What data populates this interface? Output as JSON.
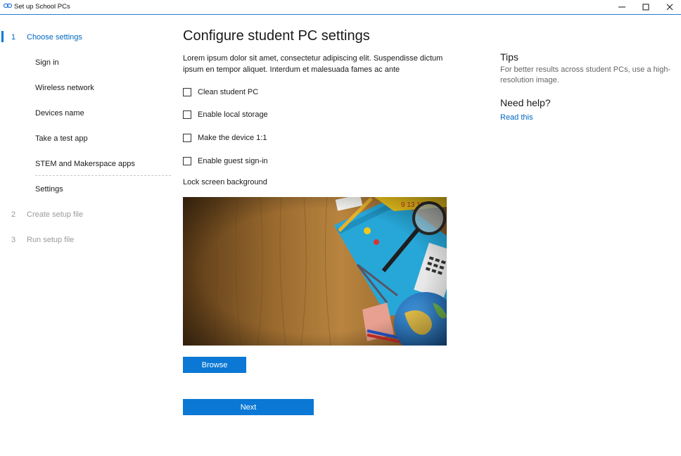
{
  "window": {
    "title": "Set up School PCs",
    "icon": "chain-link-icon",
    "controls": [
      "minimize-icon",
      "maximize-icon",
      "close-icon"
    ]
  },
  "sidebar": {
    "steps": [
      {
        "number": "1",
        "label": "Choose settings",
        "state": "active"
      },
      {
        "number": "2",
        "label": "Create setup file",
        "state": "disabled"
      },
      {
        "number": "3",
        "label": "Run setup file",
        "state": "disabled"
      }
    ],
    "sub_items": [
      "Sign in",
      "Wireless network",
      "Devices name",
      "Take a test app",
      "STEM and Makerspace apps",
      "Settings"
    ]
  },
  "main": {
    "title": "Configure student PC settings",
    "description": "Lorem ipsum dolor sit amet, consectetur adipiscing elit. Suspendisse dictum ipsum en tempor aliquet. Interdum et malesuada fames ac ante",
    "checkboxes": [
      {
        "label": "Clean student PC",
        "checked": false
      },
      {
        "label": "Enable local storage",
        "checked": false
      },
      {
        "label": "Make the device 1:1",
        "checked": false
      },
      {
        "label": "Enable guest sign-in",
        "checked": false
      }
    ],
    "lock_screen_label": "Lock screen background",
    "browse_label": "Browse",
    "next_label": "Next"
  },
  "tips": {
    "title": "Tips",
    "text": "For better results across student PCs, use a high-resolution image.",
    "help_title": "Need help?",
    "help_link": "Read this"
  },
  "colors": {
    "accent": "#0078d7",
    "button": "#0a78d4",
    "link": "#0067c0",
    "disabled": "#9a9a9a"
  }
}
